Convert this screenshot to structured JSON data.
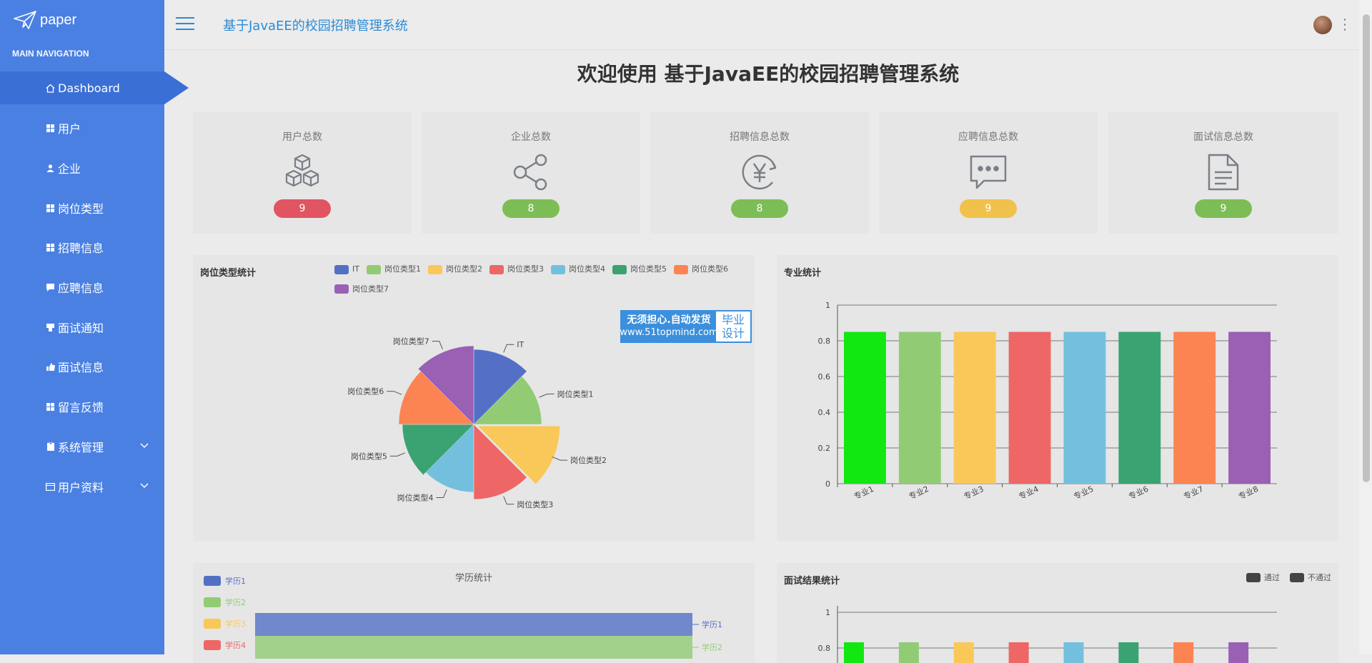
{
  "brand": {
    "logo_text": "paper"
  },
  "sidebar": {
    "section_label": "MAIN NAVIGATION",
    "items": [
      {
        "label": "Dashboard",
        "icon": "home-icon"
      },
      {
        "label": "用户",
        "icon": "grid-icon"
      },
      {
        "label": "企业",
        "icon": "user-icon"
      },
      {
        "label": "岗位类型",
        "icon": "grid-icon"
      },
      {
        "label": "招聘信息",
        "icon": "grid-icon"
      },
      {
        "label": "应聘信息",
        "icon": "comment-icon"
      },
      {
        "label": "面试通知",
        "icon": "bell-icon"
      },
      {
        "label": "面试信息",
        "icon": "thumb-icon"
      },
      {
        "label": "留言反馈",
        "icon": "grid-icon"
      },
      {
        "label": "系统管理",
        "icon": "clipboard-icon"
      },
      {
        "label": "用户资料",
        "icon": "card-icon"
      }
    ]
  },
  "header": {
    "title": "基于JavaEE的校园招聘管理系统"
  },
  "welcome": "欢迎使用 基于JavaEE的校园招聘管理系统",
  "stats": [
    {
      "label": "用户总数",
      "value": "9",
      "color": "#e05561",
      "icon": "cubes-icon"
    },
    {
      "label": "企业总数",
      "value": "8",
      "color": "#7dbd56",
      "icon": "share-icon"
    },
    {
      "label": "招聘信息总数",
      "value": "8",
      "color": "#7dbd56",
      "icon": "yen-icon"
    },
    {
      "label": "应聘信息总数",
      "value": "9",
      "color": "#f0c14b",
      "icon": "message-icon"
    },
    {
      "label": "面试信息总数",
      "value": "9",
      "color": "#7dbd56",
      "icon": "document-icon"
    }
  ],
  "watermark": {
    "line1": "无须担心.自动发货",
    "line2": "www.51topmind.com",
    "right1": "毕业",
    "right2": "设计"
  },
  "chart_data": [
    {
      "type": "pie",
      "title": "岗位类型统计",
      "categories": [
        "IT",
        "岗位类型1",
        "岗位类型2",
        "岗位类型3",
        "岗位类型4",
        "岗位类型5",
        "岗位类型6",
        "岗位类型7"
      ],
      "values": [
        1,
        1,
        1,
        1,
        1,
        1,
        1,
        1
      ],
      "colors": [
        "#5470c6",
        "#91cc75",
        "#fac858",
        "#ee6666",
        "#73c0de",
        "#3ba272",
        "#fc8452",
        "#9a60b4"
      ],
      "legend": "top"
    },
    {
      "type": "bar",
      "title": "专业统计",
      "categories": [
        "专业1",
        "专业2",
        "专业3",
        "专业4",
        "专业5",
        "专业6",
        "专业7",
        "专业8"
      ],
      "values": [
        0.85,
        0.85,
        0.85,
        0.85,
        0.85,
        0.85,
        0.85,
        0.85
      ],
      "colors": [
        "#11e811",
        "#91cc75",
        "#fac858",
        "#ee6666",
        "#73c0de",
        "#3ba272",
        "#fc8452",
        "#9a60b4"
      ],
      "ylim": [
        0,
        1
      ],
      "yticks": [
        "0",
        "0.2",
        "0.4",
        "0.6",
        "0.8",
        "1"
      ]
    },
    {
      "type": "bar",
      "title": "学历统计",
      "categories": [
        "学历1",
        "学历2",
        "学历3",
        "学历4"
      ],
      "colors": [
        "#5470c6",
        "#91cc75",
        "#fac858",
        "#ee6666"
      ],
      "visible_bar_labels": [
        "学历1",
        "学历2"
      ],
      "legend": "left"
    },
    {
      "type": "bar",
      "title": "面试结果统计",
      "series": [
        {
          "name": "通过"
        },
        {
          "name": "不通过"
        }
      ],
      "legend_color": "#444444",
      "yticks": [
        "1",
        "0.8"
      ]
    }
  ]
}
